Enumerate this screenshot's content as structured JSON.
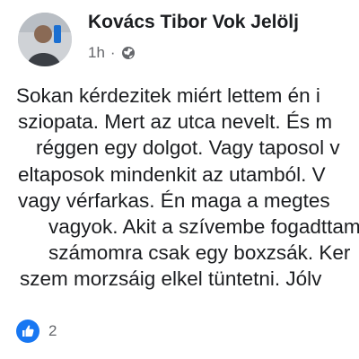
{
  "post": {
    "author": "Kovács Tibor Vok Jelölj",
    "time": "1h",
    "dot": "·",
    "audience_icon": "globe-icon",
    "avatar_icon": "avatar-photo",
    "lines": [
      "Sokan kérdezitek miért lettem én i",
      "sziopata. Mert az utca nevelt. És m",
      "réggen egy dolgot. Vagy taposol v",
      "eltaposok mindenkit az utamból. V",
      "vagy vérfarkas. Én maga a megtes",
      "vagyok. Akit a szívembe fogadttam",
      "számomra csak egy boxzsák. Ker",
      "szem morzsáig elkel tüntetni. Jólv"
    ]
  },
  "reactions": {
    "icon": "like-icon",
    "count": "2"
  },
  "colors": {
    "text": "#1c1e21",
    "secondary": "#65676b",
    "like": "#1877f2"
  }
}
